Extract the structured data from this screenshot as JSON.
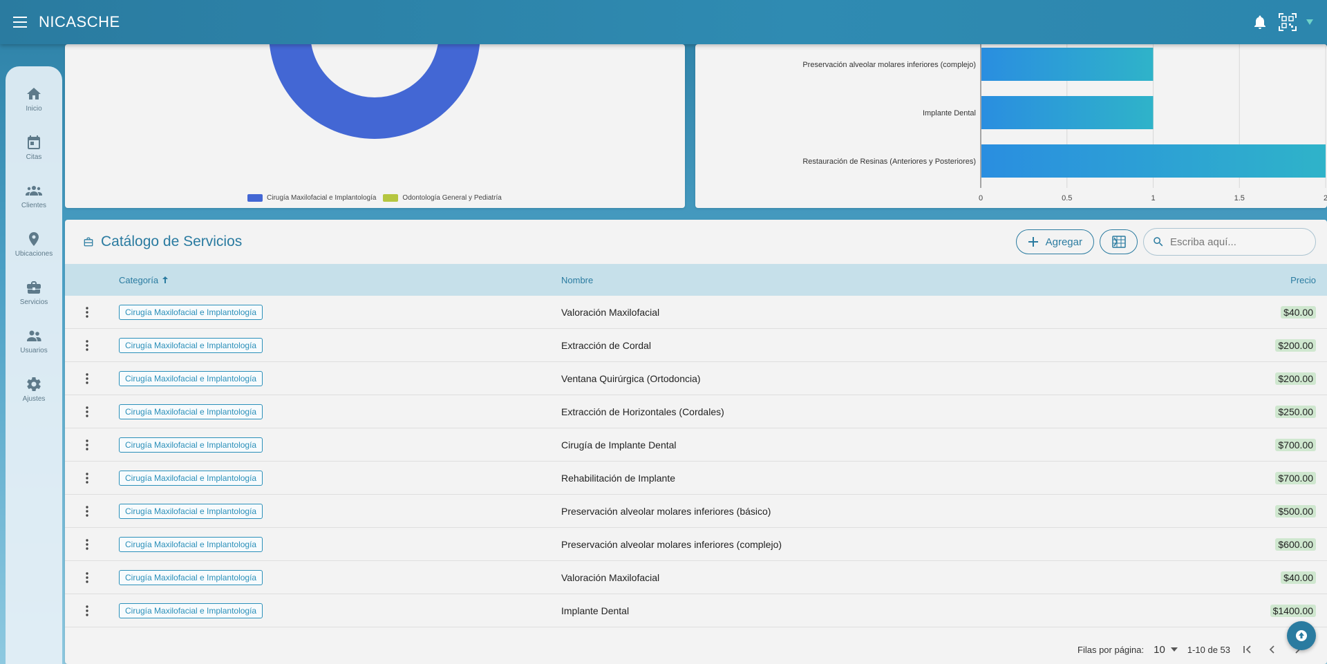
{
  "app": {
    "title": "NICASCHE"
  },
  "sidebar": {
    "items": [
      {
        "label": "Inicio",
        "icon": "home-icon"
      },
      {
        "label": "Citas",
        "icon": "calendar-icon"
      },
      {
        "label": "Clientes",
        "icon": "people-icon"
      },
      {
        "label": "Ubicaciones",
        "icon": "location-pin-icon"
      },
      {
        "label": "Servicios",
        "icon": "briefcase-icon"
      },
      {
        "label": "Usuarios",
        "icon": "users-icon"
      },
      {
        "label": "Ajustes",
        "icon": "gear-icon"
      }
    ]
  },
  "donut": {
    "legend": [
      {
        "label": "Cirugía Maxilofacial e Implantología",
        "color": "#4367d4"
      },
      {
        "label": "Odontología General y Pediatría",
        "color": "#b5c640"
      }
    ]
  },
  "chart_data": {
    "type": "bar",
    "orientation": "horizontal",
    "categories": [
      "Preservación alveolar molares inferiores (complejo)",
      "Implante Dental",
      "Restauración de Resinas (Anteriores y Posteriores)"
    ],
    "values": [
      1,
      1,
      2
    ],
    "xlim": [
      0,
      2
    ],
    "xticks": [
      "0",
      "0.5",
      "1",
      "1.5",
      "2"
    ],
    "grid": true,
    "bar_color": "#2a9fd4"
  },
  "catalog": {
    "title": "Catálogo de Servicios",
    "add_label": "Agregar",
    "search_placeholder": "Escriba aquí...",
    "columns": {
      "category": "Categoría",
      "name": "Nombre",
      "price": "Precio"
    },
    "rows": [
      {
        "category": "Cirugía Maxilofacial e Implantología",
        "name": "Valoración Maxilofacial",
        "price": "$40.00"
      },
      {
        "category": "Cirugía Maxilofacial e Implantología",
        "name": "Extracción de Cordal",
        "price": "$200.00"
      },
      {
        "category": "Cirugía Maxilofacial e Implantología",
        "name": "Ventana Quirúrgica (Ortodoncia)",
        "price": "$200.00"
      },
      {
        "category": "Cirugía Maxilofacial e Implantología",
        "name": "Extracción de Horizontales (Cordales)",
        "price": "$250.00"
      },
      {
        "category": "Cirugía Maxilofacial e Implantología",
        "name": "Cirugía de Implante Dental",
        "price": "$700.00"
      },
      {
        "category": "Cirugía Maxilofacial e Implantología",
        "name": "Rehabilitación de Implante",
        "price": "$700.00"
      },
      {
        "category": "Cirugía Maxilofacial e Implantología",
        "name": "Preservación alveolar molares inferiores (básico)",
        "price": "$500.00"
      },
      {
        "category": "Cirugía Maxilofacial e Implantología",
        "name": "Preservación alveolar molares inferiores (complejo)",
        "price": "$600.00"
      },
      {
        "category": "Cirugía Maxilofacial e Implantología",
        "name": "Valoración Maxilofacial",
        "price": "$40.00"
      },
      {
        "category": "Cirugía Maxilofacial e Implantología",
        "name": "Implante Dental",
        "price": "$1400.00"
      }
    ],
    "pagination": {
      "rows_label": "Filas por página:",
      "rows_value": "10",
      "range": "1-10 de 53"
    }
  }
}
